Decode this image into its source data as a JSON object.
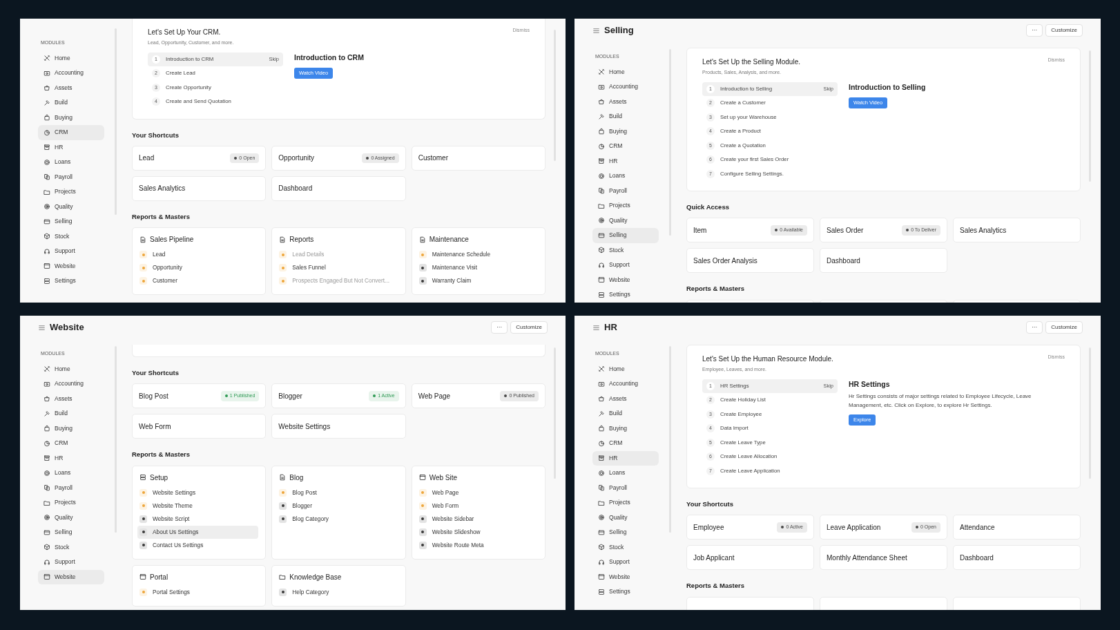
{
  "panels": [
    {
      "sidebar": {
        "heading": "MODULES",
        "items": [
          {
            "label": "Home",
            "selected": false
          },
          {
            "label": "Accounting",
            "selected": false
          },
          {
            "label": "Assets",
            "selected": false
          },
          {
            "label": "Build",
            "selected": false
          },
          {
            "label": "Buying",
            "selected": false
          },
          {
            "label": "CRM",
            "selected": true
          },
          {
            "label": "HR",
            "selected": false
          },
          {
            "label": "Loans",
            "selected": false
          },
          {
            "label": "Payroll",
            "selected": false
          },
          {
            "label": "Projects",
            "selected": false
          },
          {
            "label": "Quality",
            "selected": false
          },
          {
            "label": "Selling",
            "selected": false
          },
          {
            "label": "Stock",
            "selected": false
          },
          {
            "label": "Support",
            "selected": false
          },
          {
            "label": "Website",
            "selected": false
          },
          {
            "label": "Settings",
            "selected": false
          }
        ]
      },
      "sections": [
        {
          "kind": "onboarding",
          "title": "Let's Set Up Your CRM.",
          "subtitle": "Lead, Opportunity, Customer, and more.",
          "dismiss": "Dismiss",
          "skip": "Skip",
          "steps": [
            {
              "number": "1",
              "label": "Introduction to CRM",
              "selected": true
            },
            {
              "number": "2",
              "label": "Create Lead",
              "selected": false
            },
            {
              "number": "3",
              "label": "Create Opportunity",
              "selected": false
            },
            {
              "number": "4",
              "label": "Create and Send Quotation",
              "selected": false
            }
          ],
          "detail": {
            "title": "Introduction to CRM",
            "button": "Watch Video"
          }
        },
        {
          "kind": "shortcuts",
          "heading": "Your Shortcuts",
          "items": [
            {
              "label": "Lead",
              "badge": {
                "text": "0 Open",
                "color": "#4a4a4a"
              }
            },
            {
              "label": "Opportunity",
              "badge": {
                "text": "0 Assigned",
                "color": "#4a4a4a"
              }
            },
            {
              "label": "Customer"
            },
            {
              "label": "Sales Analytics"
            },
            {
              "label": "Dashboard"
            }
          ]
        },
        {
          "kind": "reports",
          "heading": "Reports & Masters",
          "cards": [
            {
              "kind": "document",
              "title": "Sales Pipeline",
              "links": [
                {
                  "label": "Lead",
                  "color": "#eea63a",
                  "disabled": false,
                  "hovered": false
                },
                {
                  "label": "Opportunity",
                  "color": "#eea63a",
                  "disabled": false,
                  "hovered": false
                },
                {
                  "label": "Customer",
                  "color": "#eea63a",
                  "disabled": false,
                  "hovered": false
                }
              ]
            },
            {
              "kind": "document",
              "title": "Reports",
              "links": [
                {
                  "label": "Lead Details",
                  "color": "#eea63a",
                  "disabled": true,
                  "hovered": false
                },
                {
                  "label": "Sales Funnel",
                  "color": "#eea63a",
                  "disabled": false,
                  "hovered": false
                },
                {
                  "label": "Prospects Engaged But Not Convert...",
                  "color": "#eea63a",
                  "disabled": true,
                  "hovered": false
                }
              ]
            },
            {
              "kind": "document",
              "title": "Maintenance",
              "links": [
                {
                  "label": "Maintenance Schedule",
                  "color": "#eea63a",
                  "disabled": false,
                  "hovered": false
                },
                {
                  "label": "Maintenance Visit",
                  "color": "#3a3a3a",
                  "disabled": false,
                  "hovered": false
                },
                {
                  "label": "Warranty Claim",
                  "color": "#3a3a3a",
                  "disabled": false,
                  "hovered": false
                }
              ]
            }
          ]
        }
      ]
    },
    {
      "title": "Selling",
      "actions": [
        "···",
        "Customize"
      ],
      "sidebar": {
        "heading": "MODULES",
        "items": [
          {
            "label": "Home",
            "selected": false
          },
          {
            "label": "Accounting",
            "selected": false
          },
          {
            "label": "Assets",
            "selected": false
          },
          {
            "label": "Build",
            "selected": false
          },
          {
            "label": "Buying",
            "selected": false
          },
          {
            "label": "CRM",
            "selected": false
          },
          {
            "label": "HR",
            "selected": false
          },
          {
            "label": "Loans",
            "selected": false
          },
          {
            "label": "Payroll",
            "selected": false
          },
          {
            "label": "Projects",
            "selected": false
          },
          {
            "label": "Quality",
            "selected": false
          },
          {
            "label": "Selling",
            "selected": true
          },
          {
            "label": "Stock",
            "selected": false
          },
          {
            "label": "Support",
            "selected": false
          },
          {
            "label": "Website",
            "selected": false
          },
          {
            "label": "Settings",
            "selected": false
          }
        ]
      },
      "sections": [
        {
          "kind": "onboarding",
          "title": "Let's Set Up the Selling Module.",
          "subtitle": "Products, Sales, Analysis, and more.",
          "dismiss": "Dismiss",
          "skip": "Skip",
          "steps": [
            {
              "number": "1",
              "label": "Introduction to Selling",
              "selected": true
            },
            {
              "number": "2",
              "label": "Create a Customer",
              "selected": false
            },
            {
              "number": "3",
              "label": "Set up your Warehouse",
              "selected": false
            },
            {
              "number": "4",
              "label": "Create a Product",
              "selected": false
            },
            {
              "number": "5",
              "label": "Create a Quotation",
              "selected": false
            },
            {
              "number": "6",
              "label": "Create your first Sales Order",
              "selected": false
            },
            {
              "number": "7",
              "label": "Configure Selling Settings.",
              "selected": false
            }
          ],
          "detail": {
            "title": "Introduction to Selling",
            "button": "Watch Video"
          }
        },
        {
          "kind": "shortcuts",
          "heading": "Quick Access",
          "items": [
            {
              "label": "Item",
              "badge": {
                "text": "0 Available",
                "color": "#4a4a4a"
              }
            },
            {
              "label": "Sales Order",
              "badge": {
                "text": "0 To Deliver",
                "color": "#4a4a4a"
              }
            },
            {
              "label": "Sales Analytics"
            },
            {
              "label": "Sales Order Analysis"
            },
            {
              "label": "Dashboard"
            }
          ]
        },
        {
          "kind": "reports",
          "heading": "Reports & Masters",
          "cards": [
            {
              "kind": "cut"
            },
            {
              "kind": "cut"
            },
            {
              "kind": "cut"
            }
          ]
        }
      ]
    },
    {
      "title": "Website",
      "actions": [
        "···",
        "Customize"
      ],
      "sidebar": {
        "heading": "MODULES",
        "items": [
          {
            "label": "Home",
            "selected": false
          },
          {
            "label": "Accounting",
            "selected": false
          },
          {
            "label": "Assets",
            "selected": false
          },
          {
            "label": "Build",
            "selected": false
          },
          {
            "label": "Buying",
            "selected": false
          },
          {
            "label": "CRM",
            "selected": false
          },
          {
            "label": "HR",
            "selected": false
          },
          {
            "label": "Loans",
            "selected": false
          },
          {
            "label": "Payroll",
            "selected": false
          },
          {
            "label": "Projects",
            "selected": false
          },
          {
            "label": "Quality",
            "selected": false
          },
          {
            "label": "Selling",
            "selected": false
          },
          {
            "label": "Stock",
            "selected": false
          },
          {
            "label": "Support",
            "selected": false
          },
          {
            "label": "Website",
            "selected": true
          }
        ]
      },
      "sections": [
        {
          "kind": "card_edge"
        },
        {
          "kind": "shortcuts",
          "heading": "Your Shortcuts",
          "items": [
            {
              "label": "Blog Post",
              "badge": {
                "text": "1 Published",
                "color": "#2f9a55"
              }
            },
            {
              "label": "Blogger",
              "badge": {
                "text": "1 Active",
                "color": "#2f9a55"
              }
            },
            {
              "label": "Web Page",
              "badge": {
                "text": "0 Published",
                "color": "#4a4a4a"
              }
            },
            {
              "label": "Web Form"
            },
            {
              "label": "Website Settings"
            }
          ]
        },
        {
          "kind": "reports",
          "heading": "Reports & Masters",
          "cards": [
            {
              "kind": "server",
              "title": "Setup",
              "links": [
                {
                  "label": "Website Settings",
                  "color": "#eea63a",
                  "disabled": false,
                  "hovered": false
                },
                {
                  "label": "Website Theme",
                  "color": "#eea63a",
                  "disabled": false,
                  "hovered": false
                },
                {
                  "label": "Website Script",
                  "color": "#3a3a3a",
                  "disabled": false,
                  "hovered": false
                },
                {
                  "label": "About Us Settings",
                  "color": "#3a3a3a",
                  "disabled": false,
                  "hovered": true
                },
                {
                  "label": "Contact Us Settings",
                  "color": "#3a3a3a",
                  "disabled": false,
                  "hovered": false
                }
              ]
            },
            {
              "kind": "document",
              "title": "Blog",
              "links": [
                {
                  "label": "Blog Post",
                  "color": "#eea63a",
                  "disabled": false,
                  "hovered": false
                },
                {
                  "label": "Blogger",
                  "color": "#3a3a3a",
                  "disabled": false,
                  "hovered": false
                },
                {
                  "label": "Blog Category",
                  "color": "#3a3a3a",
                  "disabled": false,
                  "hovered": false
                }
              ]
            },
            {
              "kind": "window",
              "title": "Web Site",
              "links": [
                {
                  "label": "Web Page",
                  "color": "#eea63a",
                  "disabled": false,
                  "hovered": false
                },
                {
                  "label": "Web Form",
                  "color": "#eea63a",
                  "disabled": false,
                  "hovered": false
                },
                {
                  "label": "Website Sidebar",
                  "color": "#3a3a3a",
                  "disabled": false,
                  "hovered": false
                },
                {
                  "label": "Website Slideshow",
                  "color": "#3a3a3a",
                  "disabled": false,
                  "hovered": false
                },
                {
                  "label": "Website Route Meta",
                  "color": "#3a3a3a",
                  "disabled": false,
                  "hovered": false
                }
              ]
            },
            {
              "kind": "window",
              "title": "Portal",
              "links": [
                {
                  "label": "Portal Settings",
                  "color": "#eea63a",
                  "disabled": false,
                  "hovered": false
                }
              ]
            },
            {
              "kind": "folder",
              "title": "Knowledge Base",
              "links": [
                {
                  "label": "Help Category",
                  "color": "#3a3a3a",
                  "disabled": false,
                  "hovered": false
                }
              ]
            }
          ]
        }
      ]
    },
    {
      "title": "HR",
      "actions": [
        "···",
        "Customize"
      ],
      "sidebar": {
        "heading": "MODULES",
        "items": [
          {
            "label": "Home",
            "selected": false
          },
          {
            "label": "Accounting",
            "selected": false
          },
          {
            "label": "Assets",
            "selected": false
          },
          {
            "label": "Build",
            "selected": false
          },
          {
            "label": "Buying",
            "selected": false
          },
          {
            "label": "CRM",
            "selected": false
          },
          {
            "label": "HR",
            "selected": true
          },
          {
            "label": "Loans",
            "selected": false
          },
          {
            "label": "Payroll",
            "selected": false
          },
          {
            "label": "Projects",
            "selected": false
          },
          {
            "label": "Quality",
            "selected": false
          },
          {
            "label": "Selling",
            "selected": false
          },
          {
            "label": "Stock",
            "selected": false
          },
          {
            "label": "Support",
            "selected": false
          },
          {
            "label": "Website",
            "selected": false
          },
          {
            "label": "Settings",
            "selected": false
          }
        ]
      },
      "sections": [
        {
          "kind": "onboarding",
          "title": "Let's Set Up the Human Resource Module.",
          "subtitle": "Employee, Leaves, and more.",
          "dismiss": "Dismiss",
          "skip": "Skip",
          "steps": [
            {
              "number": "1",
              "label": "HR Settings",
              "selected": true
            },
            {
              "number": "2",
              "label": "Create Holiday List",
              "selected": false
            },
            {
              "number": "3",
              "label": "Create Employee",
              "selected": false
            },
            {
              "number": "4",
              "label": "Data Import",
              "selected": false
            },
            {
              "number": "5",
              "label": "Create Leave Type",
              "selected": false
            },
            {
              "number": "6",
              "label": "Create Leave Allocation",
              "selected": false
            },
            {
              "number": "7",
              "label": "Create Leave Application",
              "selected": false
            }
          ],
          "detail": {
            "title": "HR Settings",
            "description": "Hr Settings consists of major settings related to Employee Lifecycle, Leave Management, etc. Click on Explore, to explore Hr Settings.",
            "button": "Explore"
          }
        },
        {
          "kind": "shortcuts",
          "heading": "Your Shortcuts",
          "items": [
            {
              "label": "Employee",
              "badge": {
                "text": "0 Active",
                "color": "#4a4a4a"
              }
            },
            {
              "label": "Leave Application",
              "badge": {
                "text": "0 Open",
                "color": "#4a4a4a"
              }
            },
            {
              "label": "Attendance"
            },
            {
              "label": "Job Applicant"
            },
            {
              "label": "Monthly Attendance Sheet"
            },
            {
              "label": "Dashboard"
            }
          ]
        },
        {
          "kind": "reports",
          "heading": "Reports & Masters",
          "cards": [
            {
              "kind": "cut"
            },
            {
              "kind": "cut"
            },
            {
              "kind": "cut"
            }
          ]
        }
      ]
    }
  ]
}
